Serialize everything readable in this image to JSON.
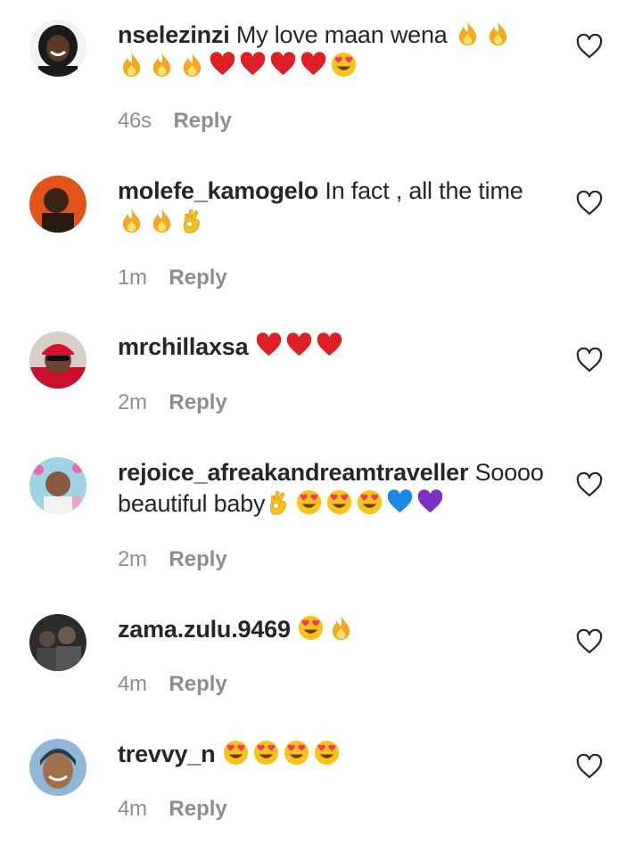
{
  "comments": [
    {
      "username": "nselezinzi",
      "text": "My love maan wena",
      "emojis_line1": [
        "fire",
        "fire"
      ],
      "emojis_line2": [
        "fire",
        "fire",
        "fire",
        "red-heart",
        "red-heart",
        "red-heart",
        "red-heart",
        "heart-eyes"
      ],
      "time": "46s",
      "reply": "Reply",
      "avatar": "woman-smiling-avatar"
    },
    {
      "username": "molefe_kamogelo",
      "text": "In fact , all the time",
      "emojis_line2": [
        "fire",
        "fire",
        "ok-hand"
      ],
      "time": "1m",
      "reply": "Reply",
      "avatar": "man-orange-background-avatar"
    },
    {
      "username": "mrchillaxsa",
      "text": "",
      "emojis_line1": [
        "red-heart",
        "red-heart",
        "red-heart"
      ],
      "time": "2m",
      "reply": "Reply",
      "avatar": "man-red-cap-sunglasses-avatar"
    },
    {
      "username": "rejoice_afreakandreamtraveller",
      "text": "Soooo",
      "text_line2": "beautiful baby",
      "emojis_line2": [
        "ok-hand",
        "heart-eyes",
        "heart-eyes",
        "heart-eyes",
        "blue-heart",
        "purple-heart"
      ],
      "time": "2m",
      "reply": "Reply",
      "avatar": "woman-floral-avatar"
    },
    {
      "username": "zama.zulu.9469",
      "text": "",
      "emojis_line1": [
        "heart-eyes",
        "fire"
      ],
      "time": "4m",
      "reply": "Reply",
      "avatar": "dark-group-photo-avatar"
    },
    {
      "username": "trevvy_n",
      "text": "",
      "emojis_line1": [
        "heart-eyes",
        "heart-eyes",
        "heart-eyes",
        "heart-eyes"
      ],
      "time": "4m",
      "reply": "Reply",
      "avatar": "woman-smiling-headwrap-avatar"
    }
  ],
  "colors": {
    "text": "#262626",
    "meta": "#8e8e8e",
    "background": "#ffffff"
  }
}
